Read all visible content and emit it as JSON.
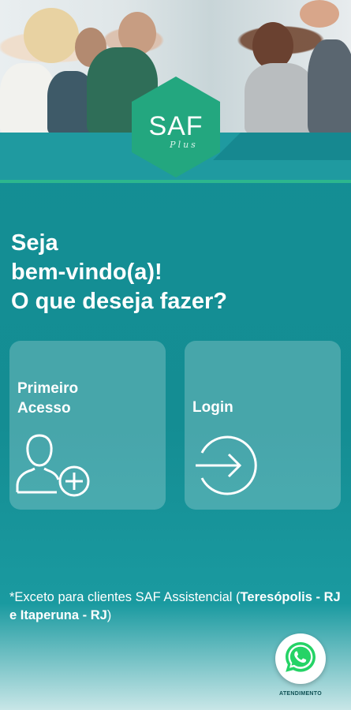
{
  "header": {
    "logo": {
      "main": "SAF",
      "sub": "Plus"
    },
    "brand_color": "#23a77f"
  },
  "welcome": {
    "line1": "Seja",
    "line2": "bem-vindo(a)!",
    "line3": "O que deseja fazer?"
  },
  "actions": [
    {
      "line1": "Primeiro",
      "line2": "Acesso",
      "icon": "add-user-icon"
    },
    {
      "label": "Login",
      "icon": "login-arrow-icon"
    }
  ],
  "note": {
    "prefix": "*Exceto para clientes SAF Assistencial (",
    "bold": "Teresópolis - RJ e Itaperuna - RJ",
    "suffix": ")"
  },
  "whatsapp": {
    "label": "ATENDIMENTO",
    "icon": "whatsapp-icon",
    "color": "#25d366"
  },
  "colors": {
    "background": "#148d93",
    "accent_line": "#2cb78e"
  }
}
